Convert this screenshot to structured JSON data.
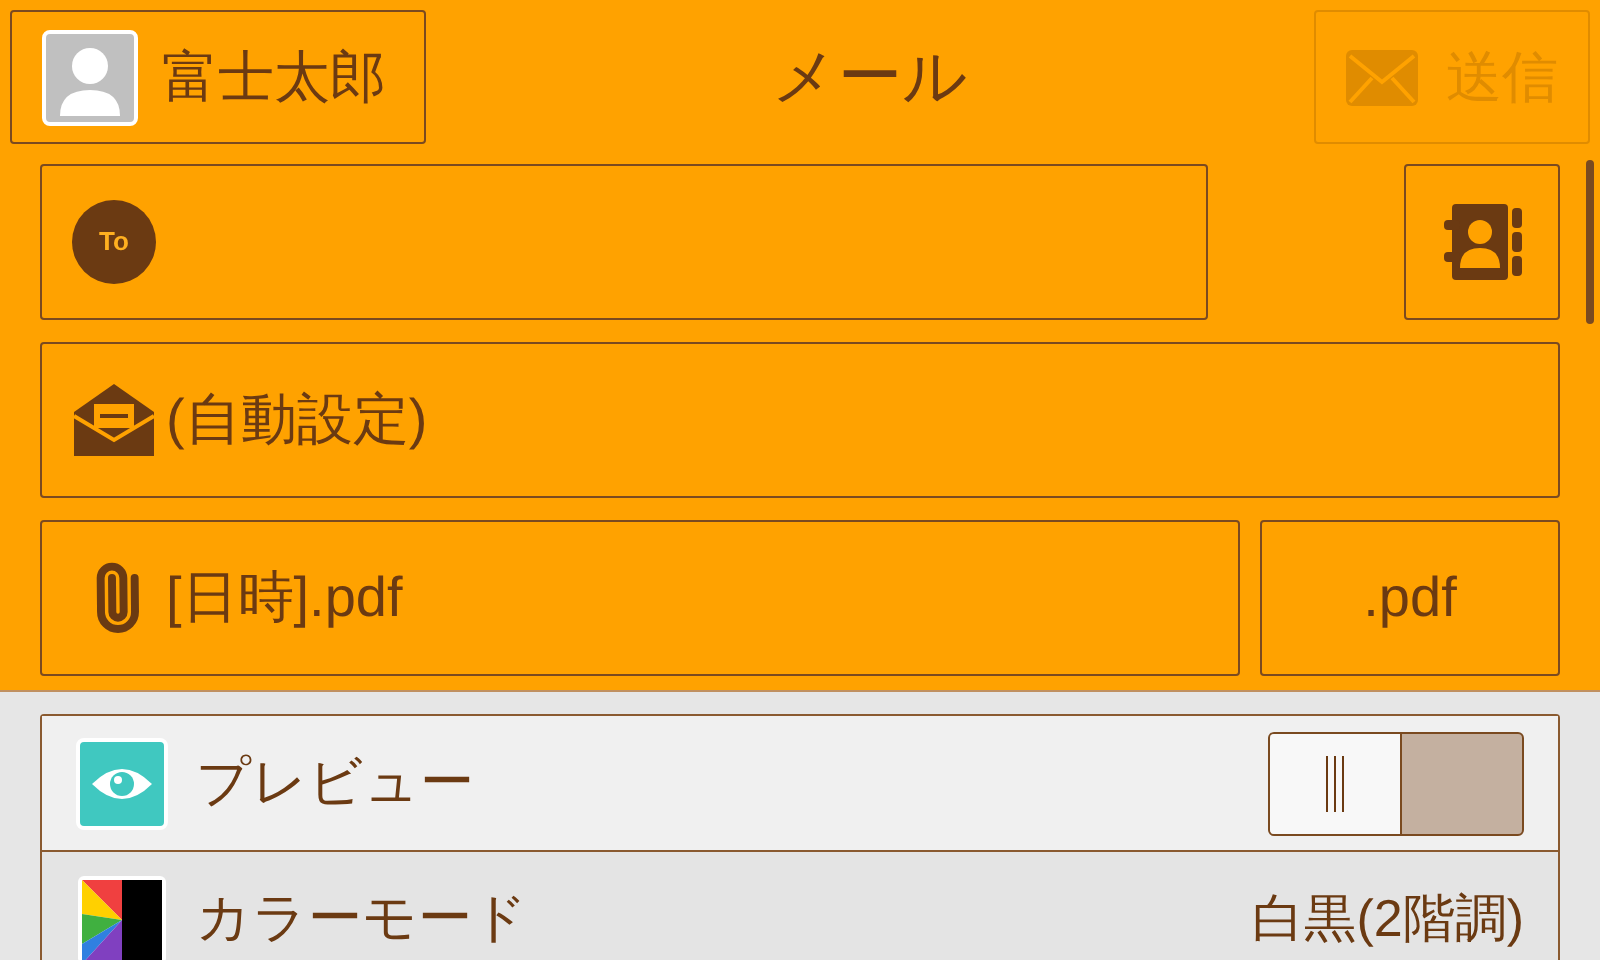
{
  "user": {
    "name": "富士太郎"
  },
  "title": "メール",
  "send_button": {
    "label": "送信",
    "disabled": true
  },
  "to_field": {
    "badge": "To"
  },
  "subject_field": {
    "value": "(自動設定)"
  },
  "attachment": {
    "filename": "[日時].pdf",
    "extension": ".pdf"
  },
  "settings": [
    {
      "kind": "toggle",
      "label": "プレビュー",
      "on": false
    },
    {
      "kind": "value",
      "label": "カラーモード",
      "value": "白黒(2階調)"
    }
  ]
}
